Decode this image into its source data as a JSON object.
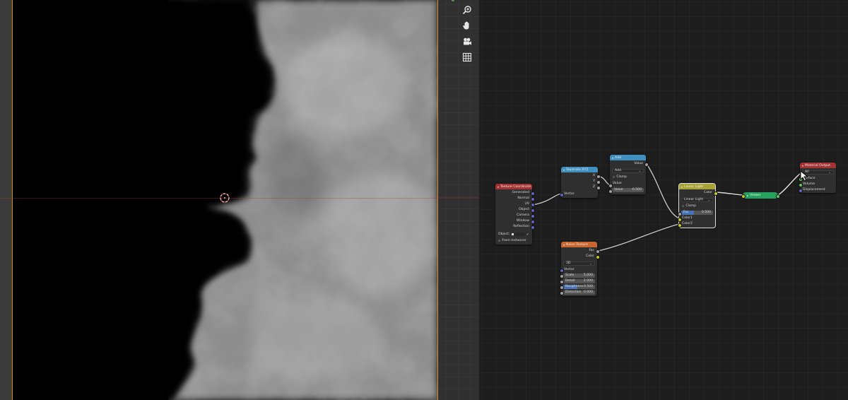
{
  "viewport": {
    "mode": "rendered",
    "accent_color": "#d98c2b"
  },
  "nav_tools": [
    {
      "name": "zoom-icon",
      "label": "zoom"
    },
    {
      "name": "hand-icon",
      "label": "pan"
    },
    {
      "name": "camera-icon",
      "label": "camera view"
    },
    {
      "name": "grid-icon",
      "label": "orthographic toggle"
    }
  ],
  "nodes": {
    "texture_coordinate": {
      "title": "Texture Coordinate",
      "header_color": "#a33232",
      "outputs": [
        "Generated",
        "Normal",
        "UV",
        "Object",
        "Camera",
        "Window",
        "Reflection"
      ],
      "object_label": "Object:",
      "from_instancer": "From Instancer"
    },
    "separate_xyz": {
      "title": "Separate XYZ",
      "header_color": "#3f8fbf",
      "outputs": [
        "X",
        "Y",
        "Z"
      ],
      "input": "Vector"
    },
    "add": {
      "title": "Add",
      "header_color": "#3f8fbf",
      "output": "Value",
      "operation": "Add",
      "clamp": "Clamp",
      "input_value": "Value",
      "field_label": "Value",
      "field_value": "-0.500"
    },
    "noise_texture": {
      "title": "Noise Texture",
      "header_color": "#c7662e",
      "outputs": [
        "Fac",
        "Color"
      ],
      "dimension": "3D",
      "input_vector": "Vector",
      "fields": [
        {
          "label": "Scale",
          "value": "5.000"
        },
        {
          "label": "Detail",
          "value": "2.000"
        },
        {
          "label": "Roughness",
          "value": "0.500"
        },
        {
          "label": "Distortion",
          "value": "0.000"
        }
      ]
    },
    "linear_light": {
      "title": "Linear Light",
      "header_color": "#a8a335",
      "output": "Color",
      "blend": "Linear Light",
      "clamp": "Clamp",
      "fac_label": "Fac",
      "fac_value": "0.500",
      "inputs": [
        "Color1",
        "Color2"
      ]
    },
    "viewer": {
      "title": "Viewer"
    },
    "material_output": {
      "title": "Material Output",
      "header_color": "#a33232",
      "target": "All",
      "inputs": [
        "Surface",
        "Volume",
        "Displacement"
      ]
    }
  }
}
